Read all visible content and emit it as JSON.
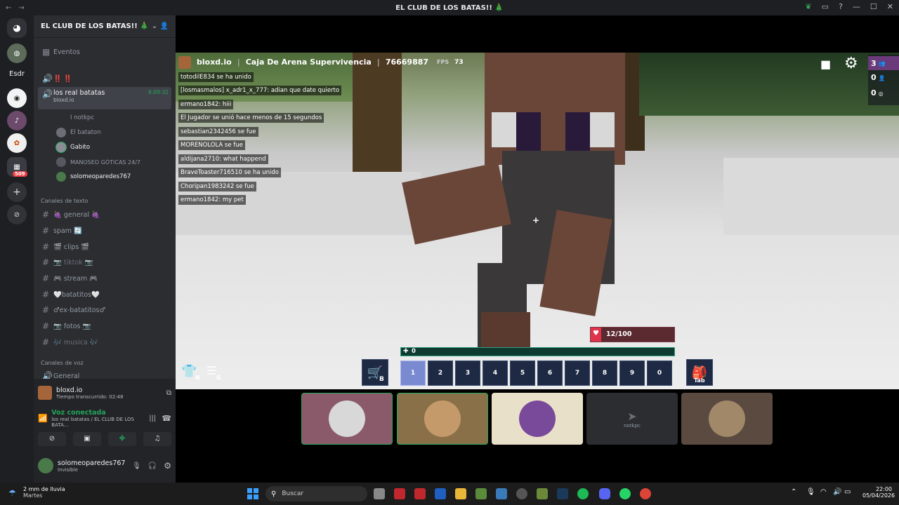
{
  "titlebar": {
    "title": "EL CLUB DE LOS BATAS!! 🎄"
  },
  "rail": {
    "label_esdr": "Esdr",
    "badge": "509"
  },
  "server": {
    "name": "EL CLUB DE LOS BATAS!! 🎄"
  },
  "sidebar": {
    "events": "Eventos",
    "voice_top": "‼️ ‼️",
    "active_channel": {
      "name": "los real batatas",
      "sub": "bloxd.io",
      "time": "6:09:32"
    },
    "members": [
      "I notkpc",
      "El bataton",
      "Gabito",
      "MANOSEO GÓTICAS 24/7",
      "solomeoparedes767"
    ],
    "text_category": "Canales de texto",
    "text_channels": [
      "🍇 general 🍇",
      "spam 🔄",
      "🎬 clips 🎬",
      "📷 tiktok 📷",
      "🎮 stream 🎮",
      "🤍batatitos🤍",
      "♂ex-batatitos♂",
      "📷 fotos 📷",
      "🎶 musica 🎶"
    ],
    "voice_category": "Canales de voz",
    "voice_channels": [
      "General"
    ]
  },
  "activity": {
    "name": "bloxd.io",
    "sub": "Tiempo transcurrido: 02:48"
  },
  "voice_status": {
    "title": "Voz conectada",
    "sub": "los real batatas / EL CLUB DE LOS BATA..."
  },
  "user": {
    "name": "solomeoparedes767",
    "status": "Invisible"
  },
  "game": {
    "brand": "bloxd.io",
    "mode": "Caja De Arena Supervivencia",
    "id": "76669887",
    "fps_label": "FPS",
    "fps": "73",
    "players": "3",
    "friends": "0",
    "online": "0",
    "health": "12/100",
    "xp": "0",
    "chat": [
      "totodilE834 se ha unido",
      "[losmasmalos] x_adr1_x_777: adian que date quierto",
      "ermano1842: hiii",
      "El Jugador se unió hace menos de 15 segundos",
      "sebastian2342456 se fue",
      "MORENOLOLA se fue",
      "aldijana2710: what happend",
      "BraveToaster716510 se ha unido",
      "Choripan1983242 se fue",
      "ermano1842: my pet"
    ],
    "slots": [
      "1",
      "2",
      "3",
      "4",
      "5",
      "6",
      "7",
      "8",
      "9",
      "0"
    ],
    "key_shop": "B",
    "key_inv": "Tab",
    "key_n": "N",
    "key_g": "G"
  },
  "stream_tiles": [
    {
      "label": ""
    },
    {
      "label": ""
    },
    {
      "label": ""
    },
    {
      "label": "notkpc"
    },
    {
      "label": ""
    }
  ],
  "taskbar": {
    "weather": "2 mm de lluvia",
    "day": "Martes",
    "search": "Buscar",
    "time": "22:00",
    "date": "05/04/2026"
  },
  "colors": {
    "accent_green": "#23a55a",
    "health_red": "#e0334c",
    "slot_selected": "#7a8ad1",
    "discord_bg": "#2b2d31"
  }
}
